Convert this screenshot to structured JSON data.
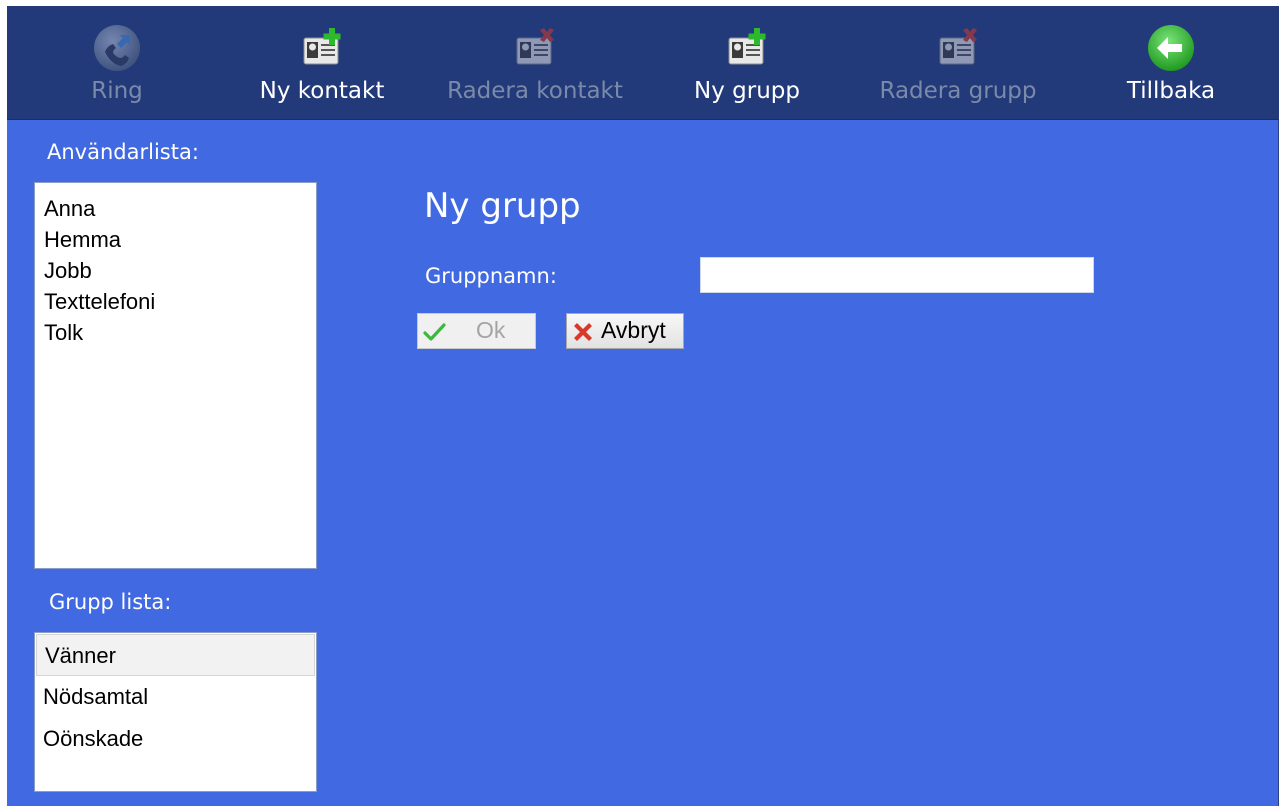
{
  "toolbar": {
    "ring": {
      "label": "Ring",
      "icon": "phone-icon",
      "enabled": false
    },
    "new_contact": {
      "label": "Ny kontakt",
      "icon": "add-contact-icon",
      "enabled": true
    },
    "delete_contact": {
      "label": "Radera kontakt",
      "icon": "delete-contact-icon",
      "enabled": false
    },
    "new_group": {
      "label": "Ny grupp",
      "icon": "add-group-icon",
      "enabled": true
    },
    "delete_group": {
      "label": "Radera grupp",
      "icon": "delete-group-icon",
      "enabled": false
    },
    "back": {
      "label": "Tillbaka",
      "icon": "back-arrow-icon",
      "enabled": true
    }
  },
  "users": {
    "heading": "Användarlista:",
    "items": [
      "Anna",
      "Hemma",
      "Jobb",
      "Texttelefoni",
      "Tolk"
    ]
  },
  "groups": {
    "heading": "Grupp lista:",
    "items": [
      "Vänner",
      "Nödsamtal",
      "Oönskade"
    ],
    "selected": "Vänner"
  },
  "form": {
    "title": "Ny grupp",
    "name_label": "Gruppnamn:",
    "name_value": "",
    "ok_label": "Ok",
    "ok_enabled": false,
    "cancel_label": "Avbryt"
  },
  "colors": {
    "background": "#4169e1",
    "toolbar": "#223a7a",
    "disabled_text": "#7b8aa8",
    "accent_green": "#2db82d",
    "delete_red": "#d9392a"
  }
}
